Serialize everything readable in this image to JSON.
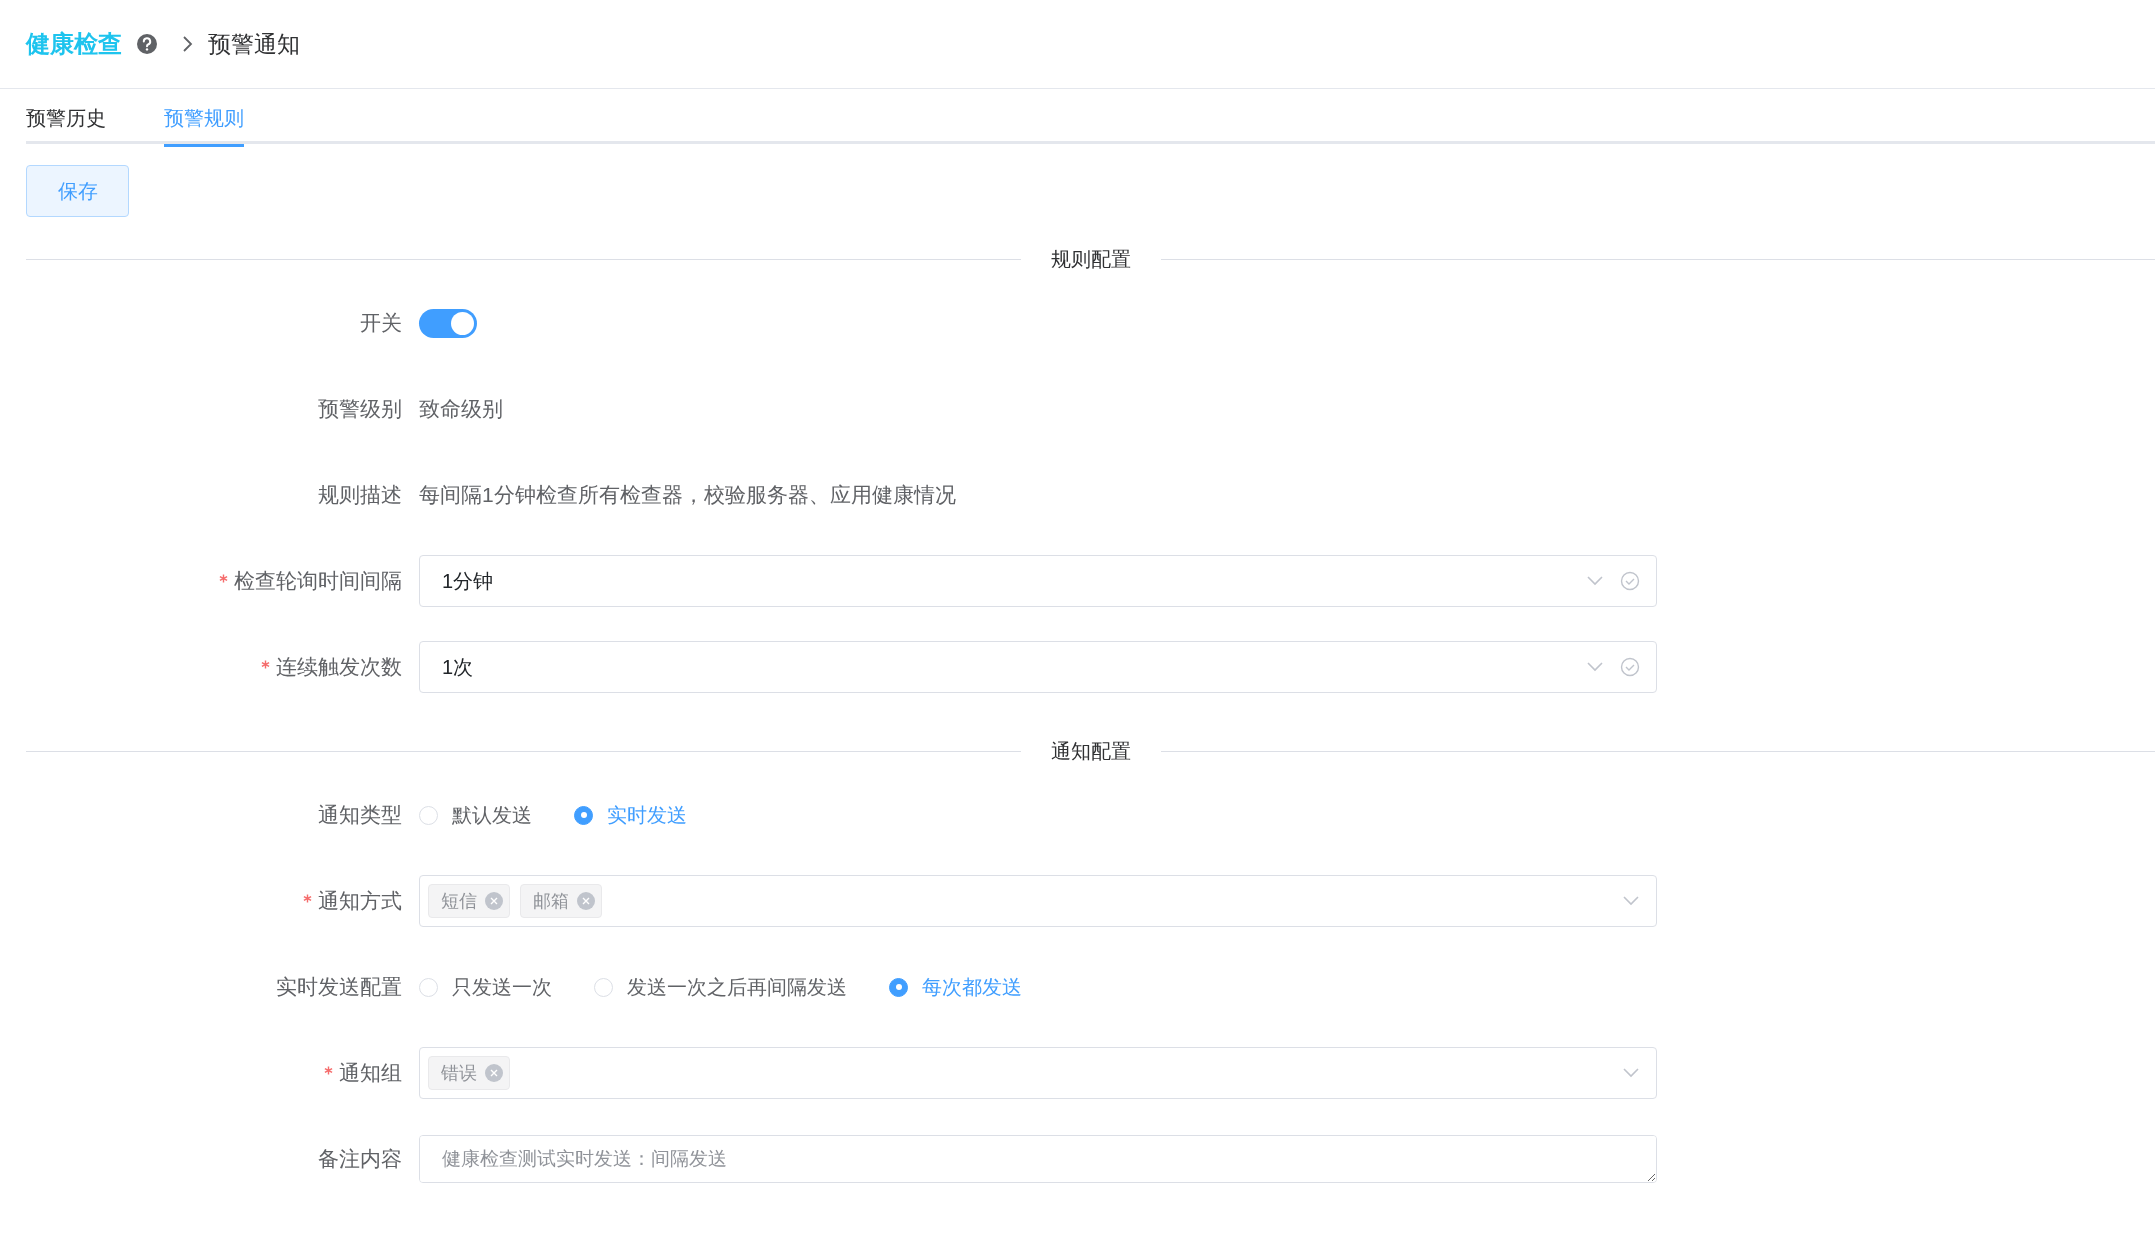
{
  "breadcrumb": {
    "title": "健康检查",
    "current": "预警通知"
  },
  "tabs": [
    {
      "label": "预警历史",
      "selected": false
    },
    {
      "label": "预警规则",
      "selected": true
    }
  ],
  "save_button": "保存",
  "sections": [
    {
      "title": "规则配置",
      "fields": [
        {
          "kind": "switch",
          "label": "开关",
          "required": false,
          "on": true
        },
        {
          "kind": "text",
          "label": "预警级别",
          "required": false,
          "value": "致命级别"
        },
        {
          "kind": "text",
          "label": "规则描述",
          "required": false,
          "value": "每间隔1分钟检查所有检查器，校验服务器、应用健康情况"
        },
        {
          "kind": "select",
          "label": "检查轮询时间间隔",
          "required": true,
          "value": "1分钟"
        },
        {
          "kind": "select",
          "label": "连续触发次数",
          "required": true,
          "value": "1次"
        }
      ]
    },
    {
      "title": "通知配置",
      "fields": [
        {
          "kind": "radio",
          "label": "通知类型",
          "required": false,
          "options": [
            {
              "label": "默认发送",
              "selected": false
            },
            {
              "label": "实时发送",
              "selected": true
            }
          ]
        },
        {
          "kind": "tags",
          "label": "通知方式",
          "required": true,
          "tags": [
            "短信",
            "邮箱"
          ]
        },
        {
          "kind": "radio",
          "label": "实时发送配置",
          "required": false,
          "options": [
            {
              "label": "只发送一次",
              "selected": false
            },
            {
              "label": "发送一次之后再间隔发送",
              "selected": false
            },
            {
              "label": "每次都发送",
              "selected": true
            }
          ]
        },
        {
          "kind": "tags",
          "label": "通知组",
          "required": true,
          "tags": [
            "错误"
          ]
        },
        {
          "kind": "textarea",
          "label": "备注内容",
          "required": false,
          "placeholder": "健康检查测试实时发送：间隔发送"
        }
      ]
    }
  ]
}
